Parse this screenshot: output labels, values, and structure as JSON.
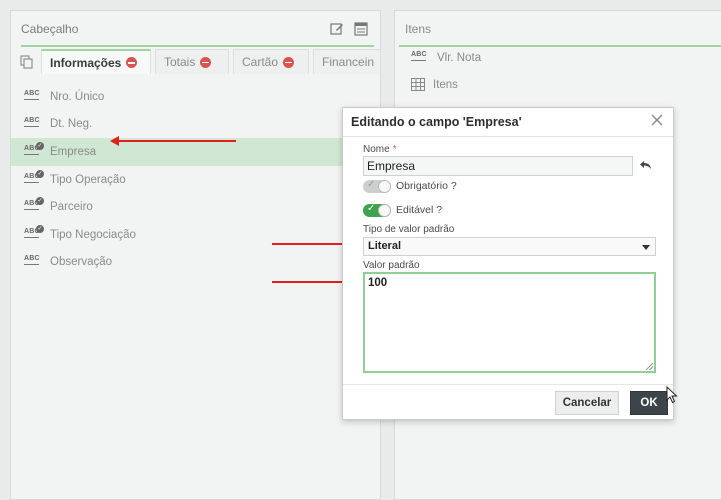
{
  "left_panel": {
    "title": "Cabeçalho",
    "tabs": [
      {
        "label": "Informações"
      },
      {
        "label": "Totais"
      },
      {
        "label": "Cartão"
      },
      {
        "label": "Financein"
      }
    ],
    "fields": [
      {
        "label": "Nro. Único"
      },
      {
        "label": "Dt. Neg."
      },
      {
        "label": "Empresa"
      },
      {
        "label": "Tipo Operação"
      },
      {
        "label": "Parceiro"
      },
      {
        "label": "Tipo Negociação"
      },
      {
        "label": "Observação"
      }
    ]
  },
  "right_panel": {
    "title": "Itens",
    "items": [
      {
        "label": "Vlr. Nota"
      },
      {
        "label": "Itens"
      }
    ]
  },
  "dialog": {
    "title": "Editando o campo 'Empresa'",
    "nome_label": "Nome",
    "required_mark": "*",
    "nome_value": "Empresa",
    "obrigatorio_label": "Obrigatório ?",
    "editavel_label": "Editável ?",
    "tipo_label": "Tipo de valor padrão",
    "tipo_value": "Literal",
    "valor_label": "Valor padrão",
    "valor_value": "100",
    "cancel_label": "Cancelar",
    "ok_label": "OK"
  },
  "colors": {
    "accent_green": "#3ea34d",
    "selected_row": "#cfe7d3",
    "badge_red": "#d9534f",
    "annotation_red": "#e0201b"
  }
}
